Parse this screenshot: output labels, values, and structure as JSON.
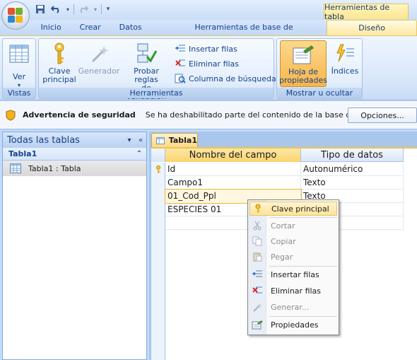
{
  "qat": {
    "undo_icon": "undo-icon",
    "redo_icon": "redo-icon"
  },
  "contextual_tab": "Herramientas de tabla",
  "tabs": [
    "Inicio",
    "Crear",
    "Datos externos",
    "Herramientas de base de datos",
    "Diseño"
  ],
  "ribbon": {
    "vistas": {
      "label": "Vistas",
      "ver": "Ver"
    },
    "herramientas": {
      "label": "Herramientas",
      "clave_principal_1": "Clave",
      "clave_principal_2": "principal",
      "generador": "Generador",
      "probar_1": "Probar reglas",
      "probar_2": "de validación",
      "insertar_filas": "Insertar filas",
      "eliminar_filas": "Eliminar filas",
      "columna_busqueda": "Columna de búsqueda"
    },
    "mostrar": {
      "label": "Mostrar u ocultar",
      "hoja_1": "Hoja de",
      "hoja_2": "propiedades",
      "indices": "Índices"
    }
  },
  "security": {
    "title": "Advertencia de seguridad",
    "message": "Se ha deshabilitado parte del contenido de la base de datos",
    "options_button": "Opciones..."
  },
  "nav": {
    "title": "Todas las tablas",
    "group": "Tabla1",
    "item": "Tabla1 : Tabla"
  },
  "document": {
    "tab": "Tabla1",
    "headers": {
      "name": "Nombre del campo",
      "type": "Tipo de datos"
    },
    "rows": [
      {
        "name": "Id",
        "type": "Autonumérico",
        "key": true
      },
      {
        "name": "Campo1",
        "type": "Texto",
        "key": false
      },
      {
        "name": "01_Cod_Ppl",
        "type": "Texto",
        "key": false
      },
      {
        "name": "ESPECIES 01",
        "type": "",
        "key": false
      }
    ]
  },
  "context_menu": {
    "items": [
      {
        "label": "Clave principal",
        "icon": "key-icon",
        "state": "highlighted"
      },
      {
        "label": "Cortar",
        "icon": "scissors-icon",
        "state": "disabled"
      },
      {
        "label": "Copiar",
        "icon": "copy-icon",
        "state": "disabled"
      },
      {
        "label": "Pegar",
        "icon": "paste-icon",
        "state": "disabled"
      },
      {
        "label": "Insertar filas",
        "icon": "insert-rows-icon",
        "state": "enabled"
      },
      {
        "label": "Eliminar filas",
        "icon": "delete-rows-icon",
        "state": "enabled"
      },
      {
        "label": "Generar...",
        "icon": "build-icon",
        "state": "disabled"
      },
      {
        "label": "Propiedades",
        "icon": "properties-icon",
        "state": "enabled"
      }
    ]
  },
  "colors": {
    "accent": "#f7b54a",
    "ribbon_text": "#15428b"
  }
}
